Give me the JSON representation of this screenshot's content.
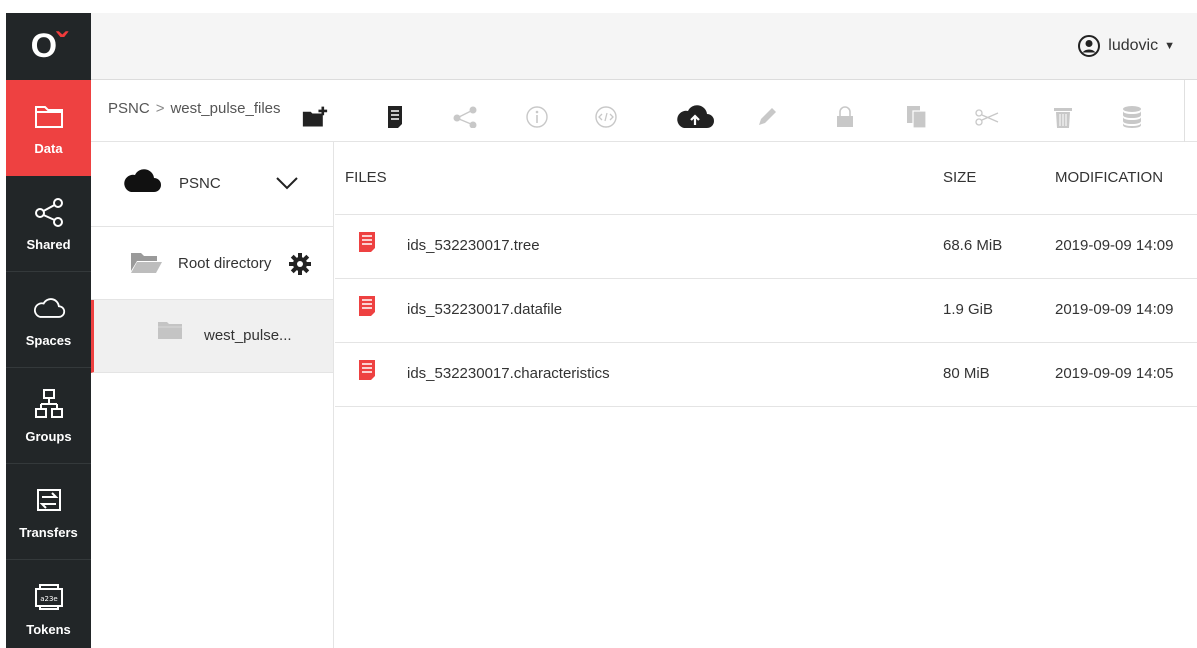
{
  "app": {
    "logo_text": "O"
  },
  "rail": {
    "items": [
      {
        "label": "Data",
        "icon": "folder-icon",
        "active": true
      },
      {
        "label": "Shared",
        "icon": "share-icon"
      },
      {
        "label": "Spaces",
        "icon": "cloud-icon"
      },
      {
        "label": "Groups",
        "icon": "groups-icon"
      },
      {
        "label": "Transfers",
        "icon": "transfers-icon"
      },
      {
        "label": "Tokens",
        "icon": "token-icon",
        "icon_text": "a23e"
      }
    ]
  },
  "user": {
    "name": "ludovic"
  },
  "breadcrumb": {
    "root": "PSNC",
    "separator": ">",
    "current": "west_pulse_files"
  },
  "toolbar": {
    "tools": [
      "new-directory-icon",
      "new-file-icon",
      "share-icon",
      "info-icon",
      "metadata-icon",
      "upload-icon",
      "rename-icon",
      "permissions-icon",
      "copy-icon",
      "cut-icon",
      "delete-icon",
      "data-distribution-icon"
    ]
  },
  "tree": {
    "space": "PSNC",
    "root_label": "Root directory",
    "selected_label": "west_pulse..."
  },
  "table": {
    "headers": {
      "files": "FILES",
      "size": "SIZE",
      "modification": "MODIFICATION"
    },
    "rows": [
      {
        "name": "ids_532230017.tree",
        "size": "68.6 MiB",
        "modified": "2019-09-09 14:09"
      },
      {
        "name": "ids_532230017.datafile",
        "size": "1.9 GiB",
        "modified": "2019-09-09 14:09"
      },
      {
        "name": "ids_532230017.characteristics",
        "size": "80 MiB",
        "modified": "2019-09-09 14:05"
      }
    ]
  },
  "colors": {
    "accent": "#ee4141",
    "rail_bg": "#222628",
    "topbar_bg": "#f5f5f5"
  }
}
